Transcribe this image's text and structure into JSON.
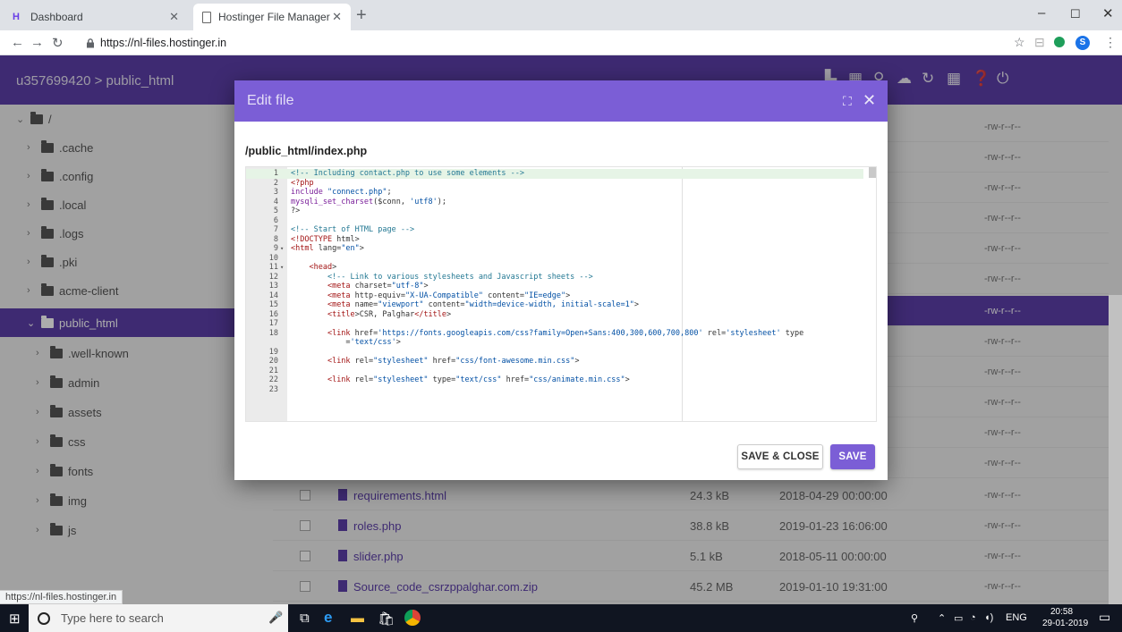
{
  "browser": {
    "tabs": [
      {
        "title": "Dashboard",
        "favicon": "hostinger-logo-icon"
      },
      {
        "title": "Hostinger File Manager",
        "favicon": "page-icon"
      }
    ],
    "new_tab": "+",
    "url": "https://nl-files.hostinger.in",
    "status_url": "https://nl-files.hostinger.in",
    "profile_initial": "S"
  },
  "app": {
    "breadcrumb": "u357699420 > public_html",
    "tree": [
      {
        "label": "/",
        "level": 0,
        "expanded": true
      },
      {
        "label": ".cache",
        "level": 1
      },
      {
        "label": ".config",
        "level": 1
      },
      {
        "label": ".local",
        "level": 1
      },
      {
        "label": ".logs",
        "level": 1
      },
      {
        "label": ".pki",
        "level": 1
      },
      {
        "label": "acme-client",
        "level": 1
      },
      {
        "label": "public_html",
        "level": 1,
        "expanded": true,
        "selected": true
      },
      {
        "label": ".well-known",
        "level": 2
      },
      {
        "label": "admin",
        "level": 2
      },
      {
        "label": "assets",
        "level": 2
      },
      {
        "label": "css",
        "level": 2
      },
      {
        "label": "fonts",
        "level": 2
      },
      {
        "label": "img",
        "level": 2
      },
      {
        "label": "js",
        "level": 2
      }
    ],
    "files_hidden_perms": [
      "-rw-r--r--",
      "-rw-r--r--",
      "-rw-r--r--",
      "-rw-r--r--",
      "-rw-r--r--",
      "-rw-r--r--",
      "-rw-r--r--",
      "-rw-r--r--",
      "-rw-r--r--",
      "-rw-r--r--",
      "-rw-r--r--",
      "-rw-r--r--"
    ],
    "files_visible": [
      {
        "name": "requirements.html",
        "size": "24.3 kB",
        "date": "2018-04-29 00:00:00",
        "perm": "-rw-r--r--"
      },
      {
        "name": "roles.php",
        "size": "38.8 kB",
        "date": "2019-01-23 16:06:00",
        "perm": "-rw-r--r--"
      },
      {
        "name": "slider.php",
        "size": "5.1 kB",
        "date": "2018-05-11 00:00:00",
        "perm": "-rw-r--r--"
      },
      {
        "name": "Source_code_csrzppalghar.com.zip",
        "size": "45.2 MB",
        "date": "2019-01-10 19:31:00",
        "perm": "-rw-r--r--"
      }
    ]
  },
  "modal": {
    "title": "Edit file",
    "path": "/public_html/index.php",
    "buttons": {
      "save_close": "SAVE & CLOSE",
      "save": "SAVE"
    },
    "code_lines": [
      {
        "n": "1",
        "text": "<!-- Including contact.php to use some elements -->"
      },
      {
        "n": "2",
        "text": "<?php"
      },
      {
        "n": "3",
        "text": "include \"connect.php\";"
      },
      {
        "n": "4",
        "text": "mysqli_set_charset($conn, 'utf8');"
      },
      {
        "n": "5",
        "text": "?>"
      },
      {
        "n": "6",
        "text": ""
      },
      {
        "n": "7",
        "text": "<!-- Start of HTML page -->"
      },
      {
        "n": "8",
        "text": "<!DOCTYPE html>"
      },
      {
        "n": "9",
        "text": "<html lang=\"en\">"
      },
      {
        "n": "10",
        "text": ""
      },
      {
        "n": "11",
        "text": "    <head>"
      },
      {
        "n": "12",
        "text": "        <!-- Link to various stylesheets and Javascript sheets -->"
      },
      {
        "n": "13",
        "text": "        <meta charset=\"utf-8\">"
      },
      {
        "n": "14",
        "text": "        <meta http-equiv=\"X-UA-Compatible\" content=\"IE=edge\">"
      },
      {
        "n": "15",
        "text": "        <meta name=\"viewport\" content=\"width=device-width, initial-scale=1\">"
      },
      {
        "n": "16",
        "text": "        <title>CSR, Palghar</title>"
      },
      {
        "n": "17",
        "text": ""
      },
      {
        "n": "18",
        "text": "        <link href='https://fonts.googleapis.com/css?family=Open+Sans:400,300,600,700,800' rel='stylesheet' type"
      },
      {
        "n": "",
        "text": "            ='text/css'>"
      },
      {
        "n": "19",
        "text": ""
      },
      {
        "n": "20",
        "text": "        <link rel=\"stylesheet\" href=\"css/font-awesome.min.css\">"
      },
      {
        "n": "21",
        "text": ""
      },
      {
        "n": "22",
        "text": "        <link rel=\"stylesheet\" type=\"text/css\" href=\"css/animate.min.css\">"
      },
      {
        "n": "23",
        "text": ""
      }
    ]
  },
  "taskbar": {
    "search_placeholder": "Type here to search",
    "lang": "ENG",
    "time": "20:58",
    "date": "29-01-2019"
  }
}
